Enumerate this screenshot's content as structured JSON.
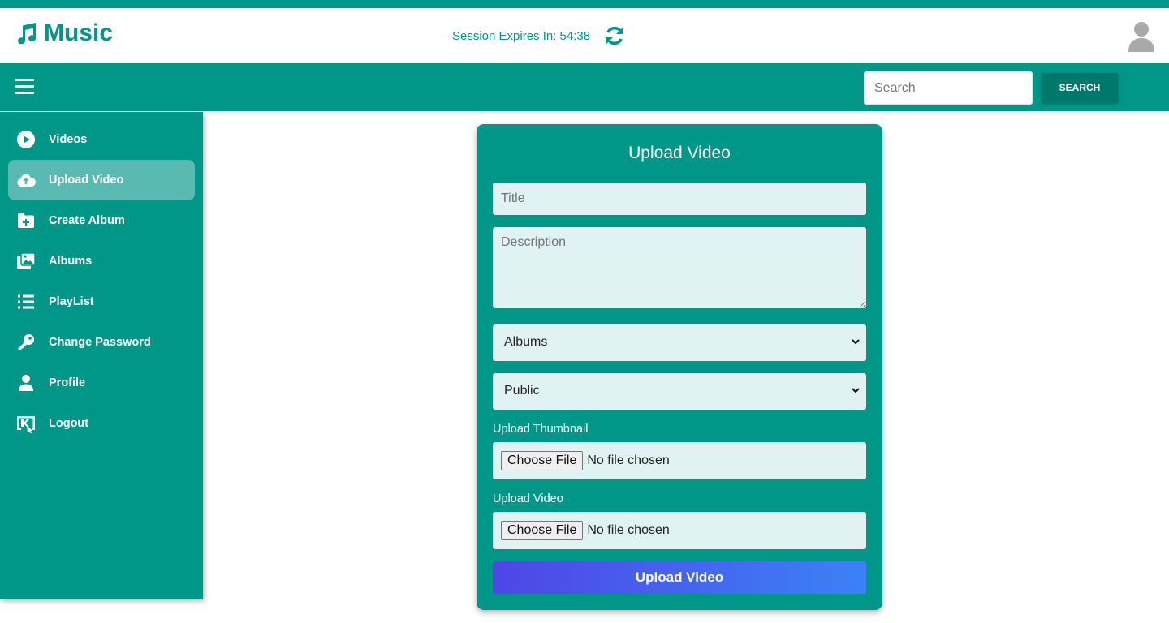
{
  "app": {
    "name": "Music",
    "brand_color": "#009688"
  },
  "header": {
    "session_label": "Session Expires In: 54:38",
    "refresh_icon": "refresh-icon",
    "avatar_icon": "user-avatar-icon"
  },
  "navbar": {
    "menu_icon": "hamburger-icon",
    "search_placeholder": "Search",
    "search_button": "SEARCH"
  },
  "sidebar": {
    "items": [
      {
        "label": "Videos",
        "icon": "play-circle-icon",
        "active": false
      },
      {
        "label": "Upload Video",
        "icon": "cloud-upload-icon",
        "active": true
      },
      {
        "label": "Create Album",
        "icon": "folder-plus-icon",
        "active": false
      },
      {
        "label": "Albums",
        "icon": "images-icon",
        "active": false
      },
      {
        "label": "PlayList",
        "icon": "list-icon",
        "active": false
      },
      {
        "label": "Change Password",
        "icon": "key-icon",
        "active": false
      },
      {
        "label": "Profile",
        "icon": "user-icon",
        "active": false
      },
      {
        "label": "Logout",
        "icon": "logout-icon",
        "active": false
      }
    ]
  },
  "form": {
    "title": "Upload Video",
    "title_placeholder": "Title",
    "description_placeholder": "Description",
    "album_select": "Albums",
    "visibility_select": "Public",
    "thumbnail_label": "Upload Thumbnail",
    "video_label": "Upload Video",
    "choose_file": "Choose File",
    "no_file": "No file chosen",
    "submit": "Upload Video"
  }
}
